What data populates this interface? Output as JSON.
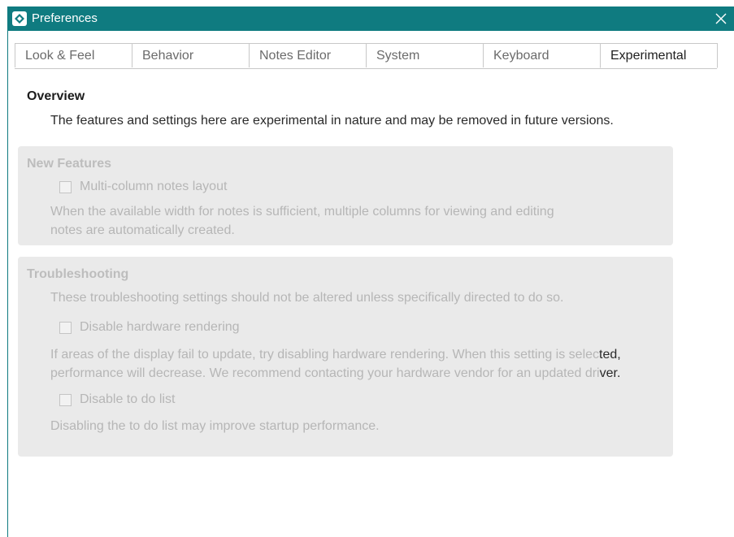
{
  "window": {
    "title": "Preferences",
    "close_symbol": "✕"
  },
  "tabs": [
    {
      "label": "Look & Feel"
    },
    {
      "label": "Behavior"
    },
    {
      "label": "Notes Editor"
    },
    {
      "label": "System"
    },
    {
      "label": "Keyboard"
    },
    {
      "label": "Experimental",
      "active": true
    }
  ],
  "overview": {
    "heading": "Overview",
    "text": "The features and settings here are experimental in nature and may be removed in future versions."
  },
  "new_features": {
    "heading": "New Features",
    "multi_column": {
      "label": "Multi-column notes layout",
      "checked": false,
      "description_line1": "When the available width for notes is sufficient, multiple columns for viewing and editing",
      "description_line2": "notes are automatically created."
    }
  },
  "troubleshooting": {
    "heading": "Troubleshooting",
    "intro": "These troubleshooting settings should not be altered unless specifically directed to do so.",
    "hardware_rendering": {
      "label": "Disable hardware rendering",
      "checked": false,
      "description_line1_a": "If areas of the display fail to update, try disabling hardware rendering. When this setting is selec",
      "description_line1_b": "ted,",
      "description_line2_a": "performance will decrease. We recommend contacting your hardware vendor for an updated dri",
      "description_line2_b": "ver."
    },
    "todo_list": {
      "label": "Disable to do list",
      "checked": false,
      "description": "Disabling the to do list may improve startup performance."
    }
  },
  "colors": {
    "titlebar": "#0f7b80",
    "disabled_text": "#b6b6b6",
    "section_background": "#eaeaea"
  },
  "icons": {
    "app": "app-logo-icon",
    "close": "close-icon"
  }
}
